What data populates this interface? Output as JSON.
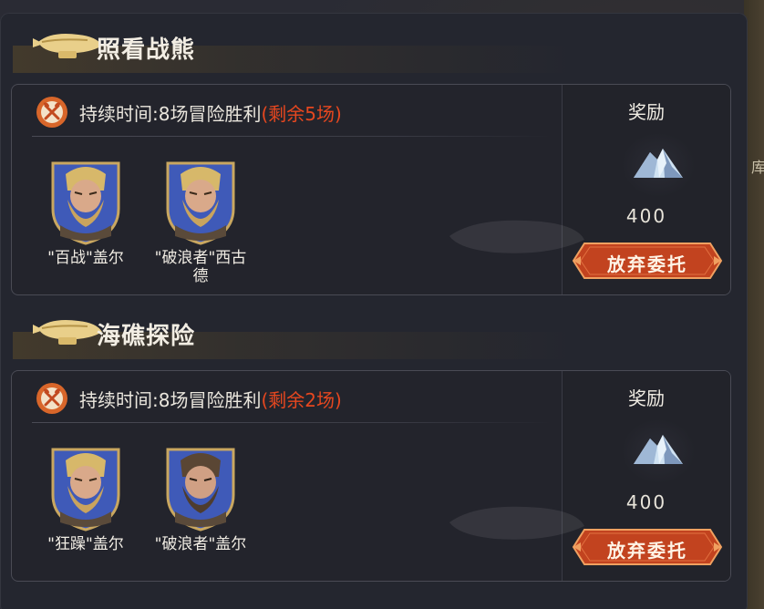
{
  "colors": {
    "remain_red": "#e6471f",
    "button_orange": "#c2431f",
    "button_border": "#f0a060",
    "badge_orange": "#d8662a",
    "shield_blue": "#3f5ab8"
  },
  "map_strip": {
    "tag": "库"
  },
  "sections": [
    {
      "title": "照看战熊",
      "icon": "airship-icon",
      "duration_text": "持续时间:8场冒险胜利",
      "remaining_text": "(剩余5场)",
      "heroes": [
        {
          "name": "\"百战\"盖尔",
          "portrait": "blonde-bearded-warrior-portrait"
        },
        {
          "name": "\"破浪者\"西古\n德",
          "portrait": "blonde-bearded-warrior-portrait"
        }
      ],
      "reward": {
        "label": "奖励",
        "icon": "crystal-ore-icon",
        "amount": "400"
      },
      "button_label": "放弃委托"
    },
    {
      "title": "海礁探险",
      "icon": "airship-icon",
      "duration_text": "持续时间:8场冒险胜利",
      "remaining_text": "(剩余2场)",
      "heroes": [
        {
          "name": "\"狂躁\"盖尔",
          "portrait": "blonde-bearded-warrior-portrait"
        },
        {
          "name": "\"破浪者\"盖尔",
          "portrait": "brown-bearded-warrior-portrait"
        }
      ],
      "reward": {
        "label": "奖励",
        "icon": "crystal-ore-icon",
        "amount": "400"
      },
      "button_label": "放弃委托"
    }
  ]
}
